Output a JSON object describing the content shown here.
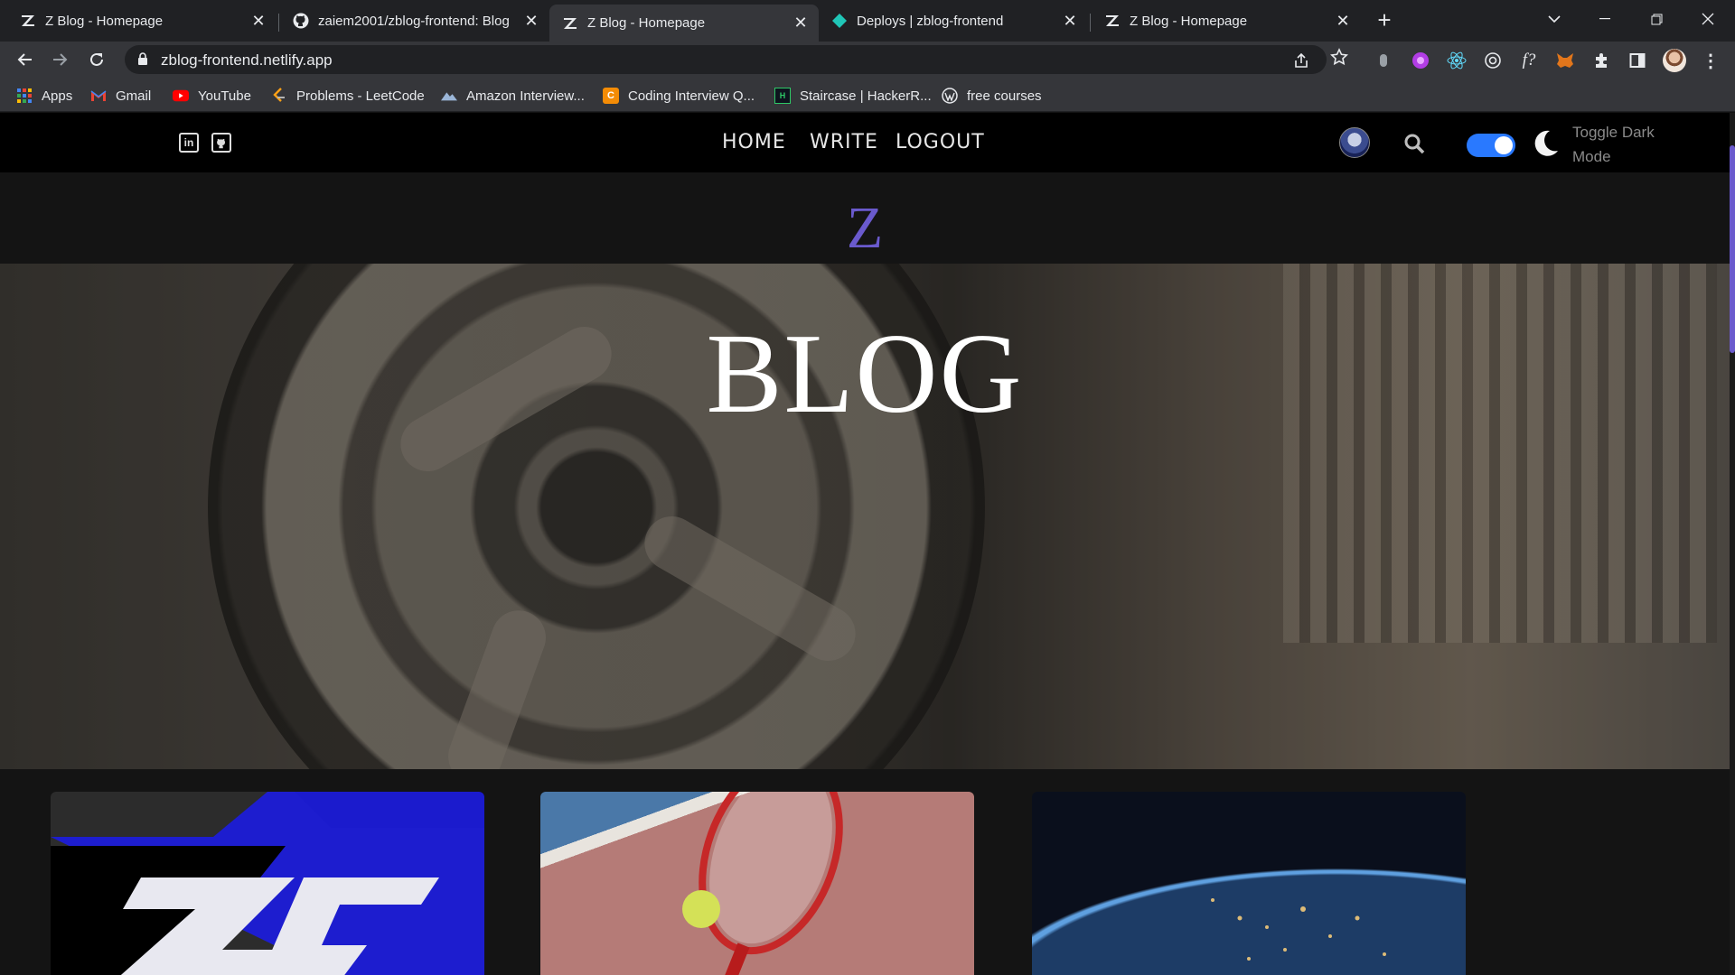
{
  "browser": {
    "tabs": [
      {
        "title": "Z Blog - Homepage",
        "icon": "z-logo-icon",
        "active": false
      },
      {
        "title": "zaiem2001/zblog-frontend: Blog",
        "icon": "github-icon",
        "active": false
      },
      {
        "title": "Z Blog - Homepage",
        "icon": "z-logo-icon",
        "active": true
      },
      {
        "title": "Deploys | zblog-frontend",
        "icon": "netlify-icon",
        "active": false
      },
      {
        "title": "Z Blog - Homepage",
        "icon": "z-logo-icon",
        "active": false
      }
    ],
    "url": "zblog-frontend.netlify.app",
    "bookmarks": [
      {
        "label": "Apps",
        "icon": "apps-grid-icon"
      },
      {
        "label": "Gmail",
        "icon": "gmail-icon"
      },
      {
        "label": "YouTube",
        "icon": "youtube-icon"
      },
      {
        "label": "Problems - LeetCode",
        "icon": "leetcode-icon"
      },
      {
        "label": "Amazon Interview...",
        "icon": "amazon-icon"
      },
      {
        "label": "Coding Interview Q...",
        "icon": "coding-interview-icon"
      },
      {
        "label": "Staircase | HackerR...",
        "icon": "hackerrank-icon"
      },
      {
        "label": "free courses",
        "icon": "wordpress-icon"
      }
    ],
    "colors": {
      "tabbar": "#202124",
      "toolbar": "#35363a"
    }
  },
  "site": {
    "social": [
      {
        "label": "in",
        "icon": "linkedin-icon"
      },
      {
        "label": "",
        "icon": "github-icon"
      }
    ],
    "nav": {
      "home": "HOME",
      "write": "WRITE",
      "logout": "LOGOUT"
    },
    "toggle_label": "Toggle Dark Mode",
    "dark_mode_on": true,
    "brand_letter": "Z",
    "brand_title": "BLOG",
    "colors": {
      "accent": "#6a5acd",
      "toggle": "#2979ff",
      "nav_bg": "#000000",
      "page_bg": "#141414"
    },
    "posts": [
      {
        "image": "zg-logo-image"
      },
      {
        "image": "tennis-racket-image"
      },
      {
        "image": "earth-at-night-image"
      }
    ]
  }
}
